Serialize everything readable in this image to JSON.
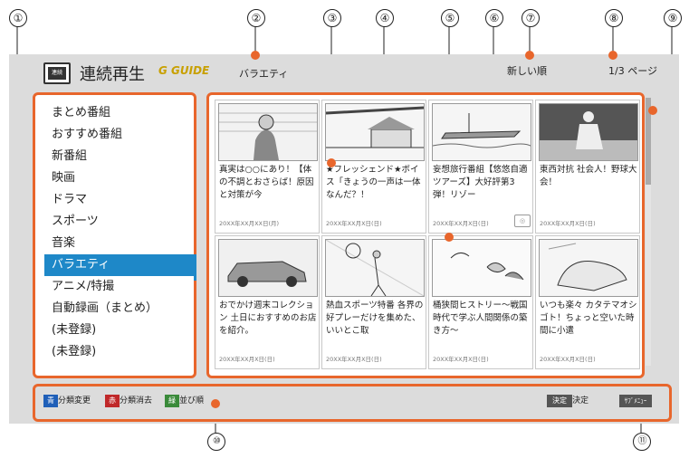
{
  "callouts": [
    "①",
    "②",
    "③",
    "④",
    "⑤",
    "⑥",
    "⑦",
    "⑧",
    "⑨",
    "⑩",
    "⑪"
  ],
  "header": {
    "logo_text": "連続",
    "title": "連続再生",
    "guide_logo": "G GUIDE",
    "genre": "バラエティ",
    "sort": "新しい順",
    "page": "1/3 ページ"
  },
  "sidebar": {
    "items": [
      {
        "label": "まとめ番組"
      },
      {
        "label": "おすすめ番組"
      },
      {
        "label": "新番組"
      },
      {
        "label": "映画"
      },
      {
        "label": "ドラマ"
      },
      {
        "label": "スポーツ"
      },
      {
        "label": "音楽"
      },
      {
        "label": "バラエティ",
        "selected": true
      },
      {
        "label": "アニメ/特撮"
      },
      {
        "label": "自動録画（まとめ）"
      },
      {
        "label": "(未登録)"
      },
      {
        "label": "(未登録)"
      }
    ]
  },
  "cards": [
    {
      "title": "真実は○○にあり！【体の不調とおさらば！原因と対策が今",
      "date": "20XX年XX月XX日(月)",
      "thumb": "woman"
    },
    {
      "title": "★フレッシェンド★ボイス「きょうの一声は一体なんだ？！",
      "date": "20XX年XX月X日(日)",
      "thumb": "building"
    },
    {
      "title": "妄想旅行番組【悠悠自適ツアーズ】大好評第3弾！リゾー",
      "date": "20XX年XX月X日(日)",
      "thumb": "ship"
    },
    {
      "title": "東西対抗 社会人！野球大会！",
      "date": "20XX年XX月X日(日)",
      "thumb": "baseball"
    },
    {
      "title": "おでかけ週末コレクション 土日におすすめのお店を紹介。",
      "date": "20XX年XX月X日(日)",
      "thumb": "car"
    },
    {
      "title": "熱血スポーツ特番 各界の好プレーだけを集めた、いいとこ取",
      "date": "20XX年XX月X日(日)",
      "thumb": "tennis"
    },
    {
      "title": "桶狭間ヒストリー～戦国時代で学ぶ人間関係の築き方～",
      "date": "20XX年XX月X日(日)",
      "thumb": "flowers"
    },
    {
      "title": "いつも楽々 カタテマオシゴト！ちょっと空いた時間に小遣",
      "date": "20XX年XX月X日(日)",
      "thumb": "hand"
    }
  ],
  "bottombar": {
    "blue_key": "青",
    "blue_label": "分類変更",
    "red_key": "赤",
    "red_label": "分類消去",
    "green_key": "緑",
    "green_label": "並び順",
    "enter_key": "決定",
    "enter_label": "決定",
    "submenu_key": "ｻﾌﾞﾒﾆｭｰ"
  },
  "colors": {
    "accent": "#e8662c",
    "selected": "#1e88c8",
    "background": "#dcdcdc",
    "blue_key": "#1f5fb8",
    "red_key": "#c0282a",
    "green_key": "#3a8a3a"
  }
}
